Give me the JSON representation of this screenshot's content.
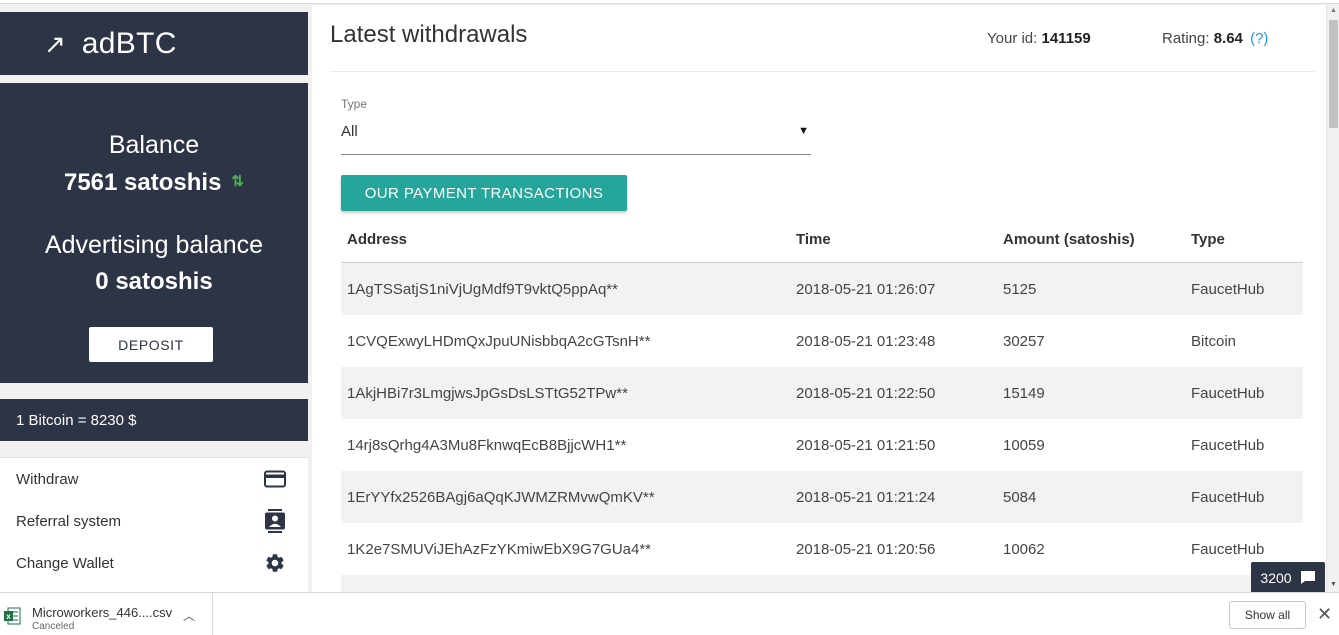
{
  "brand": {
    "arrow": "↗",
    "name": "adBTC"
  },
  "balance_card": {
    "balance_label": "Balance",
    "balance_value": "7561 satoshis",
    "adv_label": "Advertising balance",
    "adv_value": "0 satoshis",
    "deposit_label": "DEPOSIT"
  },
  "rate": "1 Bitcoin = 8230 $",
  "menu": {
    "items": [
      {
        "label": "Withdraw",
        "icon": "credit-card-icon"
      },
      {
        "label": "Referral system",
        "icon": "contacts-icon"
      },
      {
        "label": "Change Wallet",
        "icon": "gear-icon"
      }
    ]
  },
  "header": {
    "title": "Latest withdrawals",
    "id_label": "Your id:",
    "id_value": "141159",
    "rating_label": "Rating:",
    "rating_value": "8.64",
    "rating_help": "(?)"
  },
  "filter": {
    "type_label": "Type",
    "type_value": "All"
  },
  "payment_button": "OUR PAYMENT TRANSACTIONS",
  "table": {
    "columns": [
      "Address",
      "Time",
      "Amount (satoshis)",
      "Type"
    ],
    "rows": [
      [
        "1AgTSSatjS1niVjUgMdf9T9vktQ5ppAq**",
        "2018-05-21 01:26:07",
        "5125",
        "FaucetHub"
      ],
      [
        "1CVQExwyLHDmQxJpuUNisbbqA2cGTsnH**",
        "2018-05-21 01:23:48",
        "30257",
        "Bitcoin"
      ],
      [
        "1AkjHBi7r3LmgjwsJpGsDsLSTtG52TPw**",
        "2018-05-21 01:22:50",
        "15149",
        "FaucetHub"
      ],
      [
        "14rj8sQrhg4A3Mu8FknwqEcB8BjjcWH1**",
        "2018-05-21 01:21:50",
        "10059",
        "FaucetHub"
      ],
      [
        "1ErYYfx2526BAgj6aQqKJWMZRMvwQmKV**",
        "2018-05-21 01:21:24",
        "5084",
        "FaucetHub"
      ],
      [
        "1K2e7SMUViJEhAzFzYKmiwEbX9G7GUa4**",
        "2018-05-21 01:20:56",
        "10062",
        "FaucetHub"
      ]
    ]
  },
  "chat": {
    "count": "3200"
  },
  "download_bar": {
    "file_name": "Microworkers_446....csv",
    "file_status": "Canceled",
    "show_all": "Show all"
  },
  "colors": {
    "sidebar_bg": "#2c3445",
    "accent_teal": "#26a69a",
    "link_blue": "#2196f3",
    "swap_green": "#4caf50"
  }
}
